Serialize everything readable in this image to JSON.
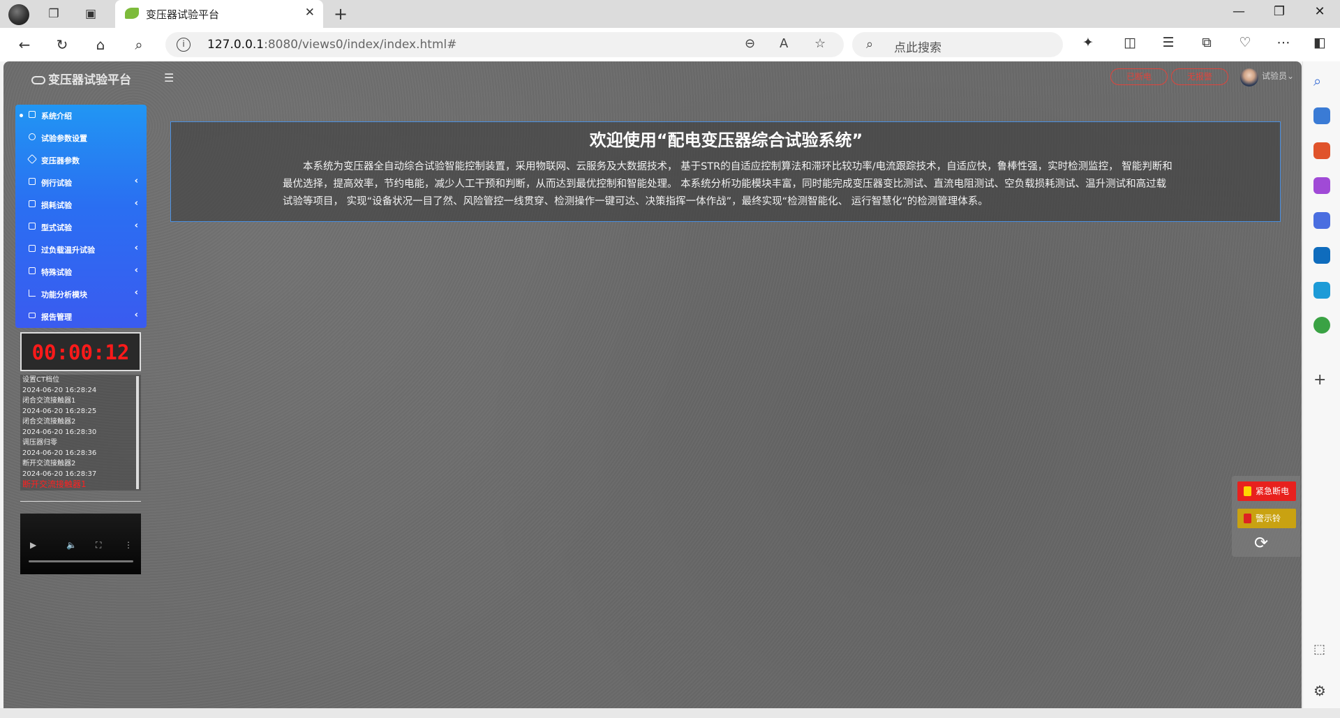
{
  "browser": {
    "tab_title": "变压器试验平台",
    "url_host": "127.0.0.1",
    "url_rest": ":8080/views0/index/index.html#",
    "search_placeholder": "点此搜索"
  },
  "app": {
    "logo_text": "变压器试验平台",
    "pill_1": "已断电",
    "pill_2": "无报警",
    "user_name": "试验员"
  },
  "menu": {
    "items": [
      {
        "label": "系统介绍",
        "icon": "grid-icon",
        "active": true
      },
      {
        "label": "试验参数设置",
        "icon": "gear-icon"
      },
      {
        "label": "变压器参数",
        "icon": "cube-icon"
      },
      {
        "label": "例行试验",
        "icon": "box-icon",
        "arrow": "‹"
      },
      {
        "label": "损耗试验",
        "icon": "box-icon",
        "arrow": "‹"
      },
      {
        "label": "型式试验",
        "icon": "box-icon",
        "arrow": "‹"
      },
      {
        "label": "过负载温升试验",
        "icon": "box-icon",
        "arrow": "‹"
      },
      {
        "label": "特殊试验",
        "icon": "box-icon",
        "arrow": "‹"
      },
      {
        "label": "功能分析模块",
        "icon": "bar-chart-icon",
        "arrow": "‹"
      },
      {
        "label": "报告管理",
        "icon": "laptop-icon",
        "arrow": "‹"
      }
    ]
  },
  "timer": {
    "value": "00:00:12"
  },
  "log": {
    "lines": [
      "设置CT档位",
      "2024-06-20 16:28:24",
      "闭合交流接触器1",
      "2024-06-20 16:28:25",
      "闭合交流接触器2",
      "2024-06-20 16:28:30",
      "调压器归零",
      "2024-06-20 16:28:36",
      "断开交流接触器2",
      "2024-06-20 16:28:37"
    ],
    "alert_line": "断开交流接触器1"
  },
  "welcome": {
    "title": "欢迎使用“配电变压器综合试验系统”",
    "body": "本系统为变压器全自动综合试验智能控制装置，采用物联网、云服务及大数据技术， 基于STR的自适应控制算法和滞环比较功率/电流跟踪技术，自适应快，鲁棒性强，实时检测监控， 智能判断和最优选择，提高效率，节约电能，减少人工干预和判断，从而达到最优控制和智能处理。 本系统分析功能模块丰富，同时能完成变压器变比测试、直流电阻测试、空负载损耗测试、温升测试和高过载试验等项目， 实现“设备状况一目了然、风险管控一线贯穿、检测操作一键可达、决策指挥一体作战”，最终实现“检测智能化、 运行智慧化”的检测管理体系。"
  },
  "fab": {
    "emergency_label": "紧急断电",
    "alarm_label": "警示铃",
    "emergency_color": "#e8211e",
    "alarm_color": "#c9a211"
  }
}
